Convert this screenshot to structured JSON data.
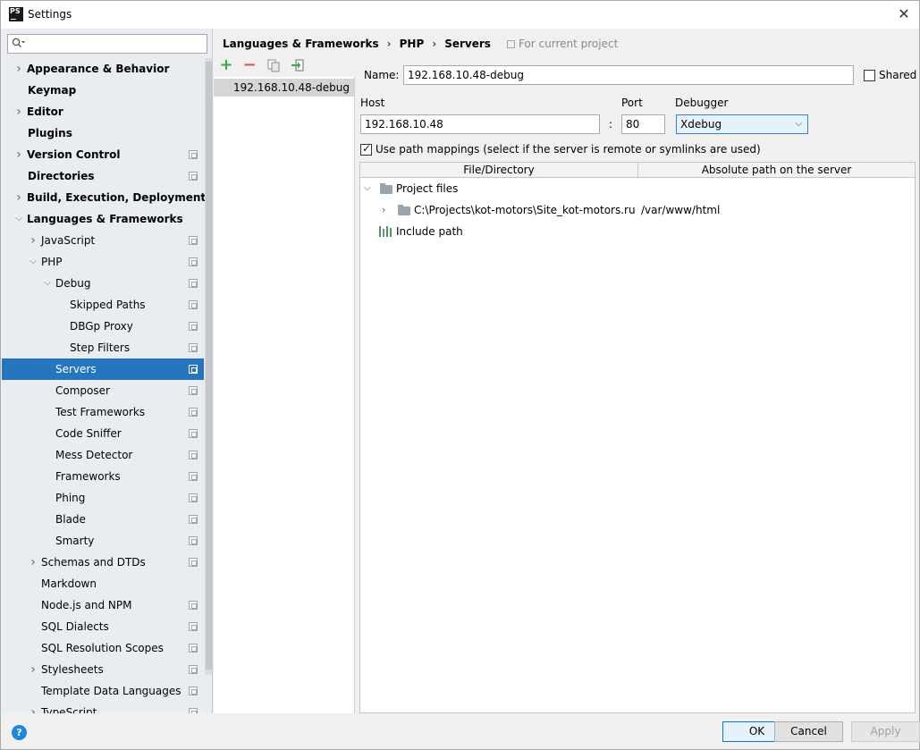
{
  "window": {
    "title": "Settings",
    "app_icon_text": "PS"
  },
  "sidebar": {
    "search": {
      "value": "",
      "placeholder": ""
    },
    "items": [
      {
        "label": "Appearance & Behavior",
        "bold": true,
        "arrow": "right",
        "level": 0,
        "project": false
      },
      {
        "label": "Keymap",
        "bold": true,
        "arrow": "",
        "level": 0,
        "project": false
      },
      {
        "label": "Editor",
        "bold": true,
        "arrow": "right",
        "level": 0,
        "project": false
      },
      {
        "label": "Plugins",
        "bold": true,
        "arrow": "",
        "level": 0,
        "project": false
      },
      {
        "label": "Version Control",
        "bold": true,
        "arrow": "right",
        "level": 0,
        "project": true
      },
      {
        "label": "Directories",
        "bold": true,
        "arrow": "",
        "level": 0,
        "project": true
      },
      {
        "label": "Build, Execution, Deployment",
        "bold": true,
        "arrow": "right",
        "level": 0,
        "project": false
      },
      {
        "label": "Languages & Frameworks",
        "bold": true,
        "arrow": "down",
        "level": 0,
        "project": false
      },
      {
        "label": "JavaScript",
        "bold": false,
        "arrow": "right",
        "level": 1,
        "project": true
      },
      {
        "label": "PHP",
        "bold": false,
        "arrow": "down",
        "level": 1,
        "project": true
      },
      {
        "label": "Debug",
        "bold": false,
        "arrow": "down",
        "level": 2,
        "project": true
      },
      {
        "label": "Skipped Paths",
        "bold": false,
        "arrow": "",
        "level": 3,
        "project": true
      },
      {
        "label": "DBGp Proxy",
        "bold": false,
        "arrow": "",
        "level": 3,
        "project": true
      },
      {
        "label": "Step Filters",
        "bold": false,
        "arrow": "",
        "level": 3,
        "project": true
      },
      {
        "label": "Servers",
        "bold": false,
        "arrow": "",
        "level": 2,
        "project": true,
        "selected": true
      },
      {
        "label": "Composer",
        "bold": false,
        "arrow": "",
        "level": 2,
        "project": true
      },
      {
        "label": "Test Frameworks",
        "bold": false,
        "arrow": "",
        "level": 2,
        "project": true
      },
      {
        "label": "Code Sniffer",
        "bold": false,
        "arrow": "",
        "level": 2,
        "project": true
      },
      {
        "label": "Mess Detector",
        "bold": false,
        "arrow": "",
        "level": 2,
        "project": true
      },
      {
        "label": "Frameworks",
        "bold": false,
        "arrow": "",
        "level": 2,
        "project": true
      },
      {
        "label": "Phing",
        "bold": false,
        "arrow": "",
        "level": 2,
        "project": true
      },
      {
        "label": "Blade",
        "bold": false,
        "arrow": "",
        "level": 2,
        "project": true
      },
      {
        "label": "Smarty",
        "bold": false,
        "arrow": "",
        "level": 2,
        "project": true
      },
      {
        "label": "Schemas and DTDs",
        "bold": false,
        "arrow": "right",
        "level": 1,
        "project": true
      },
      {
        "label": "Markdown",
        "bold": false,
        "arrow": "",
        "level": 1,
        "project": false
      },
      {
        "label": "Node.js and NPM",
        "bold": false,
        "arrow": "",
        "level": 1,
        "project": true
      },
      {
        "label": "SQL Dialects",
        "bold": false,
        "arrow": "",
        "level": 1,
        "project": true
      },
      {
        "label": "SQL Resolution Scopes",
        "bold": false,
        "arrow": "",
        "level": 1,
        "project": true
      },
      {
        "label": "Stylesheets",
        "bold": false,
        "arrow": "right",
        "level": 1,
        "project": true
      },
      {
        "label": "Template Data Languages",
        "bold": false,
        "arrow": "",
        "level": 1,
        "project": true
      },
      {
        "label": "TypeScript",
        "bold": false,
        "arrow": "right",
        "level": 1,
        "project": true
      }
    ]
  },
  "breadcrumb": {
    "items": [
      "Languages & Frameworks",
      "PHP",
      "Servers"
    ],
    "separator": "›",
    "note": "For current project"
  },
  "servers": {
    "toolbar": {
      "add": "+",
      "remove": "−"
    },
    "items": [
      "192.168.10.48-debug"
    ]
  },
  "form": {
    "name_label": "Name:",
    "name_value": "192.168.10.48-debug",
    "shared_label": "Shared",
    "shared_checked": false,
    "host_label": "Host",
    "host_value": "192.168.10.48",
    "colon": ":",
    "port_label": "Port",
    "port_value": "80",
    "debugger_label": "Debugger",
    "debugger_value": "Xdebug",
    "mappings_label": "Use path mappings (select if the server is remote or symlinks are used)",
    "mappings_checked": true
  },
  "mappings": {
    "columns": [
      "File/Directory",
      "Absolute path on the server"
    ],
    "project_files_label": "Project files",
    "rows": [
      {
        "local": "C:\\Projects\\kot-motors\\Site_kot-motors.ru",
        "remote": "/var/www/html"
      }
    ],
    "include_path_label": "Include path"
  },
  "buttons": {
    "help": "?",
    "ok": "OK",
    "cancel": "Cancel",
    "apply": "Apply"
  },
  "colors": {
    "selection": "#2675bf",
    "accent": "#0078d7",
    "add": "#3aa845",
    "remove": "#d9534f"
  }
}
